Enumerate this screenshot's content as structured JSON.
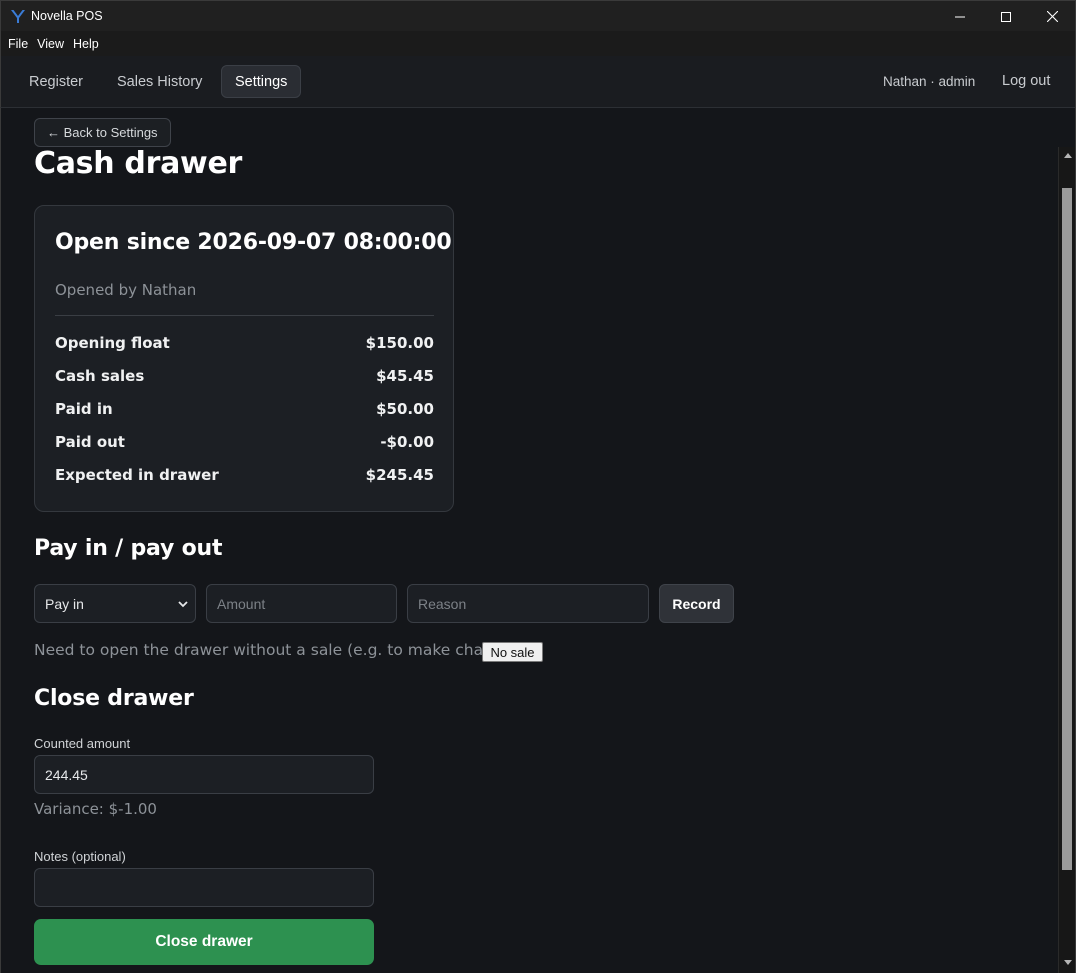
{
  "window": {
    "title": "Novella POS",
    "logo_icon": "app-logo-icon",
    "controls": [
      "minimize-icon",
      "maximize-icon",
      "close-icon"
    ]
  },
  "menu": {
    "items": [
      "File",
      "View",
      "Help"
    ]
  },
  "nav": {
    "tabs": [
      {
        "label": "Register",
        "active": false
      },
      {
        "label": "Sales History",
        "active": false
      },
      {
        "label": "Settings",
        "active": true
      }
    ],
    "user": "Nathan · admin",
    "logout": "Log out"
  },
  "page": {
    "back_label": "← Back to Settings",
    "title": "Cash drawer"
  },
  "drawer": {
    "title": "Open since 2026-09-07 08:00:00",
    "opened_by": "Opened by Nathan",
    "rows": [
      {
        "label": "Opening float",
        "value": "$150.00"
      },
      {
        "label": "Cash sales",
        "value": "$45.45"
      },
      {
        "label": "Paid in",
        "value": "$50.00"
      },
      {
        "label": "Paid out",
        "value": "-$0.00"
      },
      {
        "label": "Expected in drawer",
        "value": "$245.45"
      }
    ]
  },
  "payio": {
    "title": "Pay in / pay out",
    "type_selected": "Pay in",
    "amount_placeholder": "Amount",
    "reason_placeholder": "Reason",
    "record_label": "Record",
    "no_sale_text": "Need to open the drawer without a sale (e.g. to make change)?",
    "no_sale_label": "No sale"
  },
  "close": {
    "title": "Close drawer",
    "counted_label": "Counted amount",
    "counted_value": "244.45",
    "variance": "Variance: $-1.00",
    "notes_label": "Notes (optional)",
    "notes_value": "",
    "button_label": "Close drawer"
  },
  "colors": {
    "accent_green": "#2d9150",
    "background": "#14161a",
    "card": "#1c1f24"
  }
}
